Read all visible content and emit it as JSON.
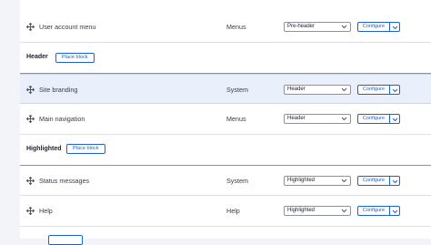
{
  "rows": [
    {
      "name": "User account menu",
      "category": "Menus",
      "region": "Pre-header",
      "action": "Configure"
    },
    {
      "name": "Site branding",
      "category": "System",
      "region": "Header",
      "action": "Configure"
    },
    {
      "name": "Main navigation",
      "category": "Menus",
      "region": "Header",
      "action": "Configure"
    },
    {
      "name": "Status messages",
      "category": "System",
      "region": "Highlighted",
      "action": "Configure"
    },
    {
      "name": "Help",
      "category": "Help",
      "region": "Highlighted",
      "action": "Configure"
    }
  ],
  "regions": [
    {
      "title": "Header",
      "place_label": "Place block"
    },
    {
      "title": "Highlighted",
      "place_label": "Place block"
    }
  ],
  "colors": {
    "accent": "#1e64c8",
    "highlight_row": "#e9f0fc"
  },
  "icons": {
    "drag": "drag-handle-icon",
    "dropdown": "chevron-down-icon"
  }
}
